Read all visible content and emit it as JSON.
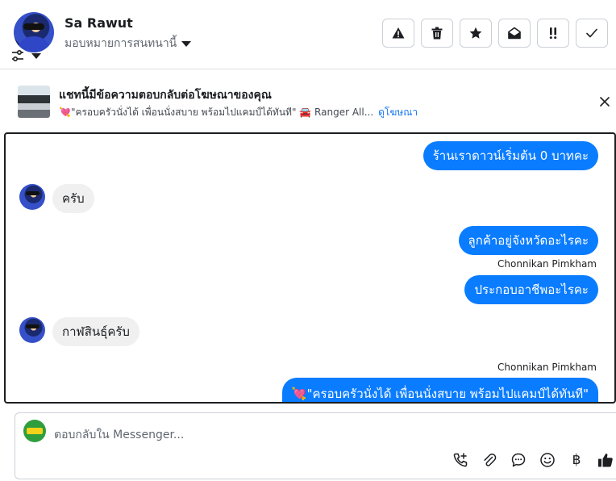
{
  "header": {
    "contact_name": "Sa Rawut",
    "assign_label": "มอบหมายการสนทนานี้",
    "actions": [
      {
        "name": "report-button",
        "icon": "warning-icon"
      },
      {
        "name": "delete-button",
        "icon": "trash-icon"
      },
      {
        "name": "star-button",
        "icon": "star-icon"
      },
      {
        "name": "mark-unread-button",
        "icon": "envelope-open-icon"
      },
      {
        "name": "follow-up-button",
        "icon": "double-exclamation-icon"
      },
      {
        "name": "mark-done-button",
        "icon": "check-icon"
      }
    ]
  },
  "ad_banner": {
    "title": "แชทนี้มีข้อความตอบกลับต่อโฆษณาของคุณ",
    "subtitle": "💘\"ครอบครัวนั่งได้ เพื่อนนั่งสบาย พร้อมไปแคมป์ได้ทันที\" 🚘 Ranger All...",
    "link": "ดูโฆษณา"
  },
  "thread": {
    "messages": [
      {
        "from": "page",
        "text": "ร้านเราดาวน์เริ่มต้น 0 บาทคะ"
      },
      {
        "from": "contact",
        "text": "ครับ"
      },
      {
        "from": "page",
        "text": "ลูกค้าอยู่จังหวัดอะไรคะ",
        "sender": "Chonnikan Pimkham"
      },
      {
        "from": "page",
        "text": "ประกอบอาชีพอะไรคะ"
      },
      {
        "from": "contact",
        "text": "กาฬสินธุ์ครับ"
      },
      {
        "from": "page",
        "text": "💘\"ครอบครัวนั่งได้ เพื่อนนั่งสบาย พร้อมไปแคมป์ได้ทันที\"",
        "sender": "Chonnikan Pimkham"
      }
    ]
  },
  "composer": {
    "placeholder": "ตอบกลับใน Messenger...",
    "tools": [
      "call-icon",
      "attachment-icon",
      "saved-reply-icon",
      "emoji-icon",
      "baht-icon",
      "like-icon"
    ],
    "baht_symbol": "฿"
  },
  "colors": {
    "outgoing_bubble": "#0a7cff",
    "incoming_bubble": "#f0f0f0",
    "link": "#1877f2"
  }
}
